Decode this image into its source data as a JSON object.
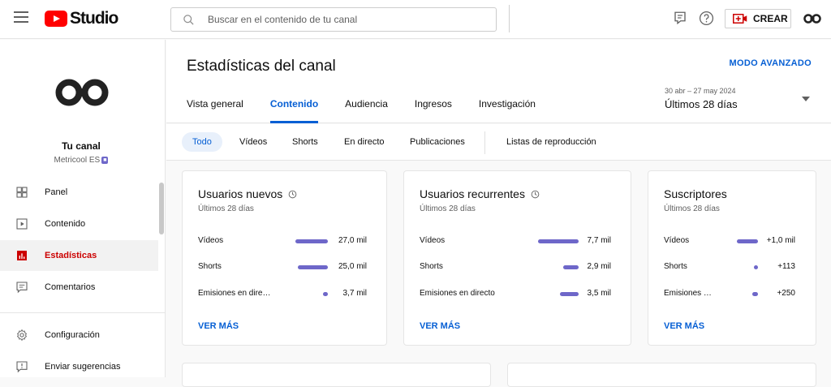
{
  "header": {
    "logo_text": "Studio",
    "search_placeholder": "Buscar en el contenido de tu canal",
    "create_label": "CREAR"
  },
  "sidebar": {
    "channel_name": "Tu canal",
    "channel_subtitle": "Metricool ES",
    "items": [
      {
        "label": "Panel",
        "icon": "dashboard-icon"
      },
      {
        "label": "Contenido",
        "icon": "content-icon"
      },
      {
        "label": "Estadísticas",
        "icon": "analytics-icon",
        "active": true
      },
      {
        "label": "Comentarios",
        "icon": "comments-icon"
      },
      {
        "label": "Configuración",
        "icon": "settings-icon"
      },
      {
        "label": "Enviar sugerencias",
        "icon": "feedback-icon"
      }
    ]
  },
  "main": {
    "title": "Estadísticas del canal",
    "advanced_mode": "MODO AVANZADO",
    "tabs": [
      {
        "label": "Vista general"
      },
      {
        "label": "Contenido",
        "active": true
      },
      {
        "label": "Audiencia"
      },
      {
        "label": "Ingresos"
      },
      {
        "label": "Investigación"
      }
    ],
    "date_range": "30 abr – 27 may 2024",
    "date_label": "Últimos 28 días",
    "chips": [
      {
        "label": "Todo",
        "active": true
      },
      {
        "label": "Vídeos"
      },
      {
        "label": "Shorts"
      },
      {
        "label": "En directo"
      },
      {
        "label": "Publicaciones"
      },
      {
        "label": "Listas de reproducción"
      }
    ],
    "cards": [
      {
        "title": "Usuarios nuevos",
        "subtitle": "Últimos 28 días",
        "rows": [
          {
            "label": "Vídeos",
            "value": "27,0 mil",
            "share": 1.0
          },
          {
            "label": "Shorts",
            "value": "25,0 mil",
            "share": 0.93
          },
          {
            "label": "Emisiones en dire…",
            "value": "3,7 mil",
            "share": 0.14
          }
        ],
        "link": "VER MÁS"
      },
      {
        "title": "Usuarios recurrentes",
        "subtitle": "Últimos 28 días",
        "rows": [
          {
            "label": "Vídeos",
            "value": "7,7 mil",
            "share": 1.0
          },
          {
            "label": "Shorts",
            "value": "2,9 mil",
            "share": 0.38
          },
          {
            "label": "Emisiones en directo",
            "value": "3,5 mil",
            "share": 0.46
          }
        ],
        "link": "VER MÁS"
      },
      {
        "title": "Suscriptores",
        "subtitle": "Últimos 28 días",
        "rows": [
          {
            "label": "Vídeos",
            "value": "+1,0 mil",
            "share": 1.0
          },
          {
            "label": "Shorts",
            "value": "+113",
            "share": 0.11
          },
          {
            "label": "Emisiones …",
            "value": "+250",
            "share": 0.25
          }
        ],
        "link": "VER MÁS"
      }
    ]
  },
  "colors": {
    "accent": "#065fd4",
    "active_nav": "#cc0000",
    "bar": "#6e67c9",
    "youtube_red": "#ff0000"
  }
}
